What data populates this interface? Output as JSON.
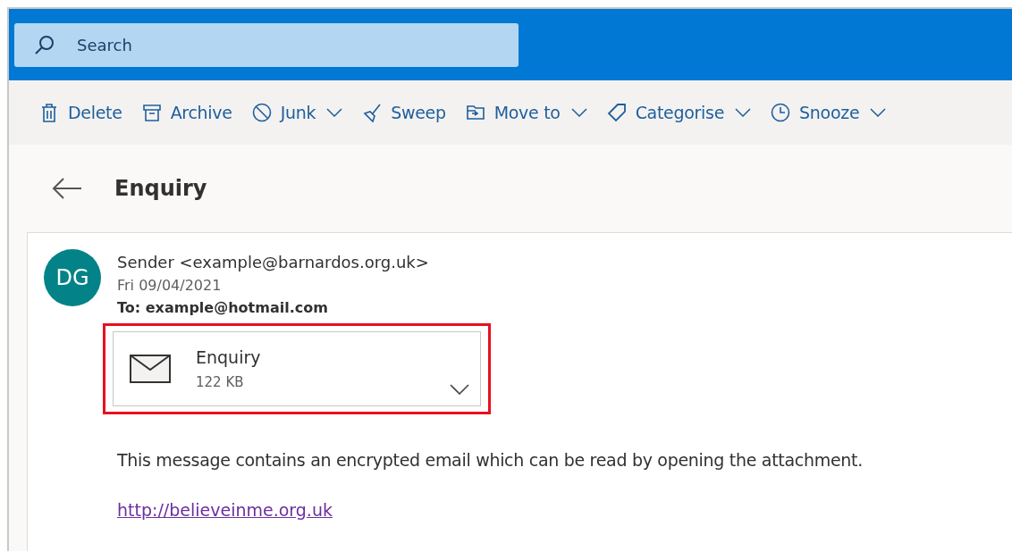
{
  "search": {
    "placeholder": "Search"
  },
  "toolbar": [
    {
      "label": "Delete",
      "has_menu": false
    },
    {
      "label": "Archive",
      "has_menu": false
    },
    {
      "label": "Junk",
      "has_menu": true
    },
    {
      "label": "Sweep",
      "has_menu": false
    },
    {
      "label": "Move to",
      "has_menu": true
    },
    {
      "label": "Categorise",
      "has_menu": true
    },
    {
      "label": "Snooze",
      "has_menu": true
    }
  ],
  "message": {
    "subject": "Enquiry",
    "avatar": "DG",
    "from": "Sender <example@barnardos.org.uk>",
    "date": "Fri 09/04/2021",
    "to": "To: example@hotmail.com",
    "attachment": {
      "name": "Enquiry",
      "size": "122 KB",
      "highlighted": true
    },
    "body": "This message contains an encrypted email which can be read by opening the attachment.",
    "link": "http://believeinme.org.uk"
  }
}
